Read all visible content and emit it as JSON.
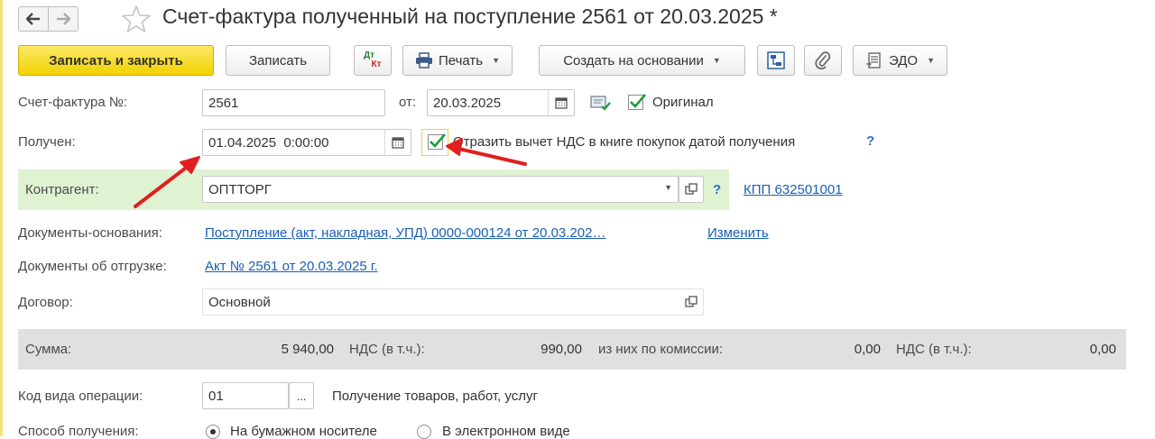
{
  "header": {
    "title": "Счет-фактура полученный на поступление 2561 от 20.03.2025 *"
  },
  "toolbar": {
    "save_close": "Записать и закрыть",
    "save": "Записать",
    "dtkt_top": "Дт",
    "dtkt_bottom": "Кт",
    "print": "Печать",
    "create_based": "Создать на основании",
    "edo": "ЭДО"
  },
  "form": {
    "invoice_label": "Счет-фактура №:",
    "invoice_number": "2561",
    "date_from_label": "от:",
    "invoice_date": "20.03.2025",
    "original_label": "Оригинал",
    "received_label": "Получен:",
    "received_datetime": "01.04.2025  0:00:00",
    "vat_deduction_label": "Отразить вычет НДС в книге покупок датой получения",
    "help_mark": "?",
    "counterparty_label": "Контрагент:",
    "counterparty_value": "ОПТТОРГ",
    "kpp_link": "КПП 632501001",
    "base_docs_label": "Документы-основания:",
    "base_docs_link": "Поступление (акт, накладная, УПД) 0000-000124 от 20.03.202…",
    "change_link": "Изменить",
    "shipment_docs_label": "Документы об отгрузке:",
    "shipment_docs_link": "Акт № 2561 от 20.03.2025 г.",
    "contract_label": "Договор:",
    "contract_value": "Основной",
    "operation_code_label": "Код вида операции:",
    "operation_code_value": "01",
    "operation_code_btn": "...",
    "operation_code_desc": "Получение товаров, работ, услуг",
    "receipt_method_label": "Способ получения:",
    "receipt_paper": "На бумажном носителе",
    "receipt_electronic": "В электронном виде"
  },
  "totals": {
    "sum_label": "Сумма:",
    "sum_value": "5 940,00",
    "vat_label": "НДС (в т.ч.):",
    "vat_value": "990,00",
    "commission_label": "из них по комиссии:",
    "commission_value": "0,00",
    "commission_vat_label": "НДС (в т.ч.):",
    "commission_vat_value": "0,00"
  },
  "colors": {
    "primary_button": "#f3d100",
    "counterparty_band": "#dff2d2",
    "totals_band": "#e0e0e0",
    "link": "#1a5fb4",
    "annotation_arrow": "#e02020",
    "checkmark": "#1e9c3a"
  },
  "icons": {
    "back": "arrow-left-icon",
    "forward": "arrow-right-icon",
    "favorite": "star-icon",
    "print": "printer-icon",
    "structure": "structure-icon",
    "attach": "paperclip-icon",
    "edo": "document-exchange-icon",
    "calendar": "calendar-icon",
    "open": "open-form-icon"
  }
}
